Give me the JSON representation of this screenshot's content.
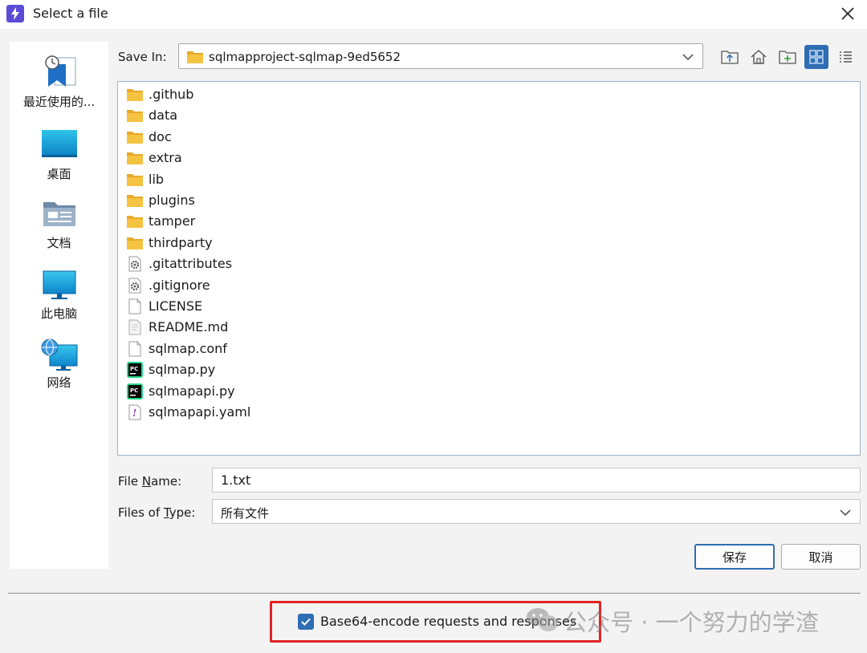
{
  "window": {
    "title": "Select a file",
    "close_icon": "close-icon",
    "app_icon": "bolt-icon",
    "app_icon_color": "#5b4bd6"
  },
  "sidebar": {
    "items": [
      {
        "label": "最近使用的...",
        "icon": "recent-items-icon"
      },
      {
        "label": "桌面",
        "icon": "desktop-icon"
      },
      {
        "label": "文档",
        "icon": "documents-icon"
      },
      {
        "label": "此电脑",
        "icon": "computer-icon"
      },
      {
        "label": "网络",
        "icon": "network-icon"
      }
    ]
  },
  "location": {
    "label": "Save In:",
    "value": "sqlmapproject-sqlmap-9ed5652",
    "toolbar": [
      "up-folder-icon",
      "home-icon",
      "new-folder-icon",
      "icon-view-icon",
      "list-view-icon"
    ],
    "active_view": "icon-view-icon"
  },
  "files": [
    {
      "name": ".github",
      "type": "folder"
    },
    {
      "name": "data",
      "type": "folder"
    },
    {
      "name": "doc",
      "type": "folder"
    },
    {
      "name": "extra",
      "type": "folder"
    },
    {
      "name": "lib",
      "type": "folder"
    },
    {
      "name": "plugins",
      "type": "folder"
    },
    {
      "name": "tamper",
      "type": "folder"
    },
    {
      "name": "thirdparty",
      "type": "folder"
    },
    {
      "name": ".gitattributes",
      "type": "config"
    },
    {
      "name": ".gitignore",
      "type": "config"
    },
    {
      "name": "LICENSE",
      "type": "file"
    },
    {
      "name": "README.md",
      "type": "markdown"
    },
    {
      "name": "sqlmap.conf",
      "type": "file"
    },
    {
      "name": "sqlmap.py",
      "type": "python"
    },
    {
      "name": "sqlmapapi.py",
      "type": "python"
    },
    {
      "name": "sqlmapapi.yaml",
      "type": "yaml"
    }
  ],
  "form": {
    "file_name_label": "File Name:",
    "file_name_value": "1.txt",
    "files_type_label": "Files of Type:",
    "files_type_value": "所有文件",
    "save_label": "保存",
    "cancel_label": "取消"
  },
  "options": {
    "base64_label": "Base64-encode requests and responses",
    "base64_checked": true
  },
  "watermark": {
    "text": "公众号 · 一个努力的学渣"
  },
  "colors": {
    "accent": "#2f6db3",
    "folder": "#f5c342",
    "highlight": "#e02424"
  }
}
